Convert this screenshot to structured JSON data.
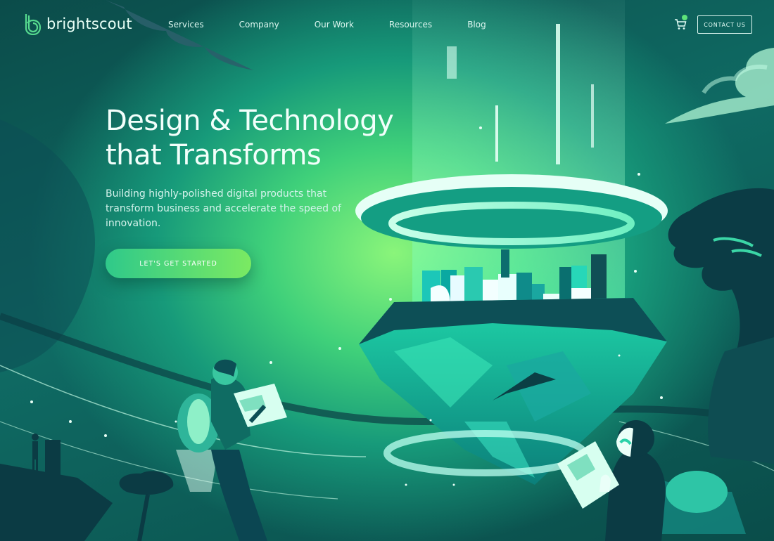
{
  "brand": {
    "name": "brightscout"
  },
  "nav": {
    "items": [
      {
        "label": "Services"
      },
      {
        "label": "Company"
      },
      {
        "label": "Our Work"
      },
      {
        "label": "Resources"
      },
      {
        "label": "Blog"
      }
    ]
  },
  "header": {
    "cart_icon": "cart-icon",
    "contact_label": "CONTACT US"
  },
  "hero": {
    "title": "Design & Technology that Transforms",
    "subtitle": "Building highly-polished digital products that transform business and accelerate the speed of innovation.",
    "cta_label": "LET'S GET STARTED"
  },
  "colors": {
    "background_dark": "#0b4a48",
    "accent_green": "#7bea62",
    "accent_teal": "#2fc98a"
  }
}
